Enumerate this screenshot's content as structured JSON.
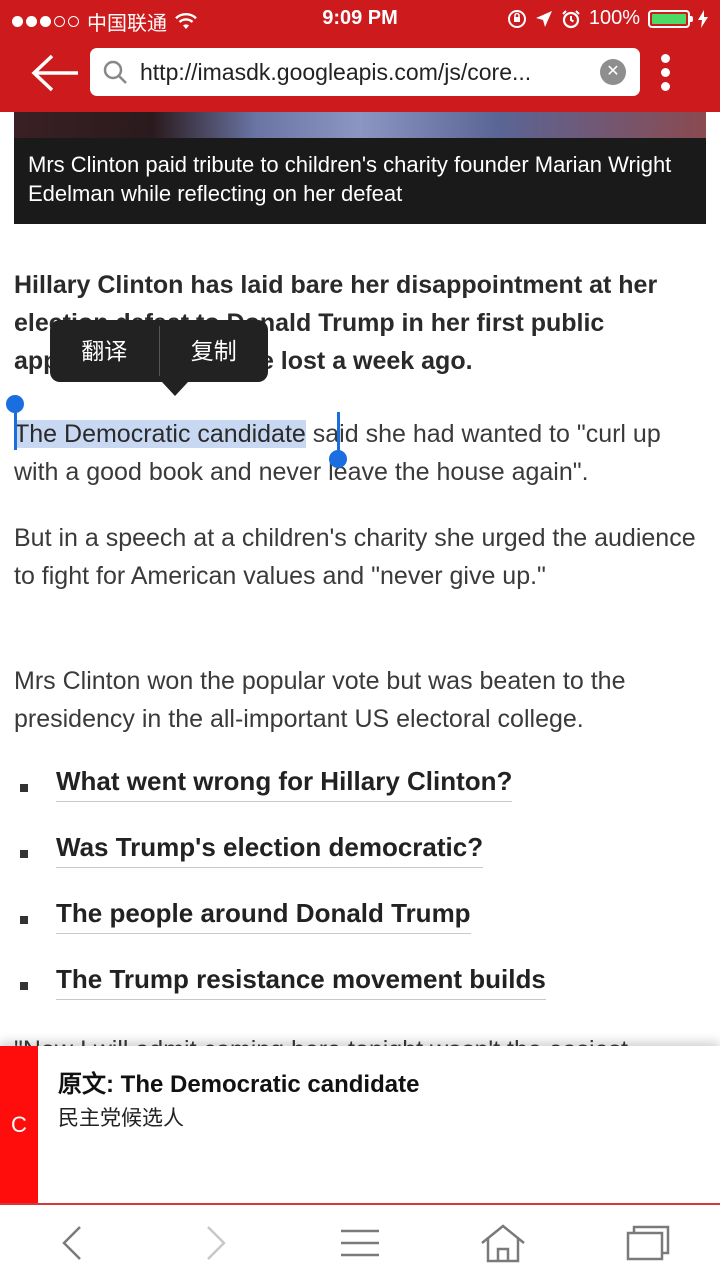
{
  "status_bar": {
    "carrier": "中国联通",
    "time": "9:09 PM",
    "battery_percent": "100%",
    "battery_level": 1.0,
    "accent_color": "#cc1a1d"
  },
  "toolbar": {
    "url": "http://imasdk.googleapis.com/js/core..."
  },
  "article": {
    "image_caption": "Mrs Clinton paid tribute to children's charity founder Marian Wright Edelman while reflecting on her defeat",
    "lead": "Hillary Clinton has laid bare her disappointment at her election defeat to Donald Trump in her first public appearance since she lost a week ago.",
    "p1_selected": "The Democratic candidate",
    "p1_rest": " said she had wanted to \"curl up with a good book and never leave the house again\".",
    "p2": "But in a speech at a children's charity she urged the audience to fight for American values and \"never give up.\"",
    "p3": "Mrs Clinton won the popular vote but was beaten to the presidency in the all-important US electoral college.",
    "links": [
      "What went wrong for Hillary Clinton?",
      "Was Trump's election democratic?",
      "The people around Donald Trump",
      "The Trump resistance movement builds"
    ],
    "partial_line": "\"Now I will admit coming here tonight wasn't the easiest"
  },
  "context_menu": {
    "translate": "翻译",
    "copy": "复制"
  },
  "translation_panel": {
    "tab_label": "C",
    "source": "原文: The Democratic candidate",
    "translation": "民主党候选人"
  },
  "icons": {
    "back": "back-arrow-icon",
    "search": "search-icon",
    "clear": "clear-icon",
    "menu": "more-vertical-icon",
    "nav_back": "chevron-left-icon",
    "nav_forward": "chevron-right-icon",
    "nav_menu": "hamburger-icon",
    "nav_home": "home-icon",
    "nav_tabs": "tabs-icon"
  }
}
